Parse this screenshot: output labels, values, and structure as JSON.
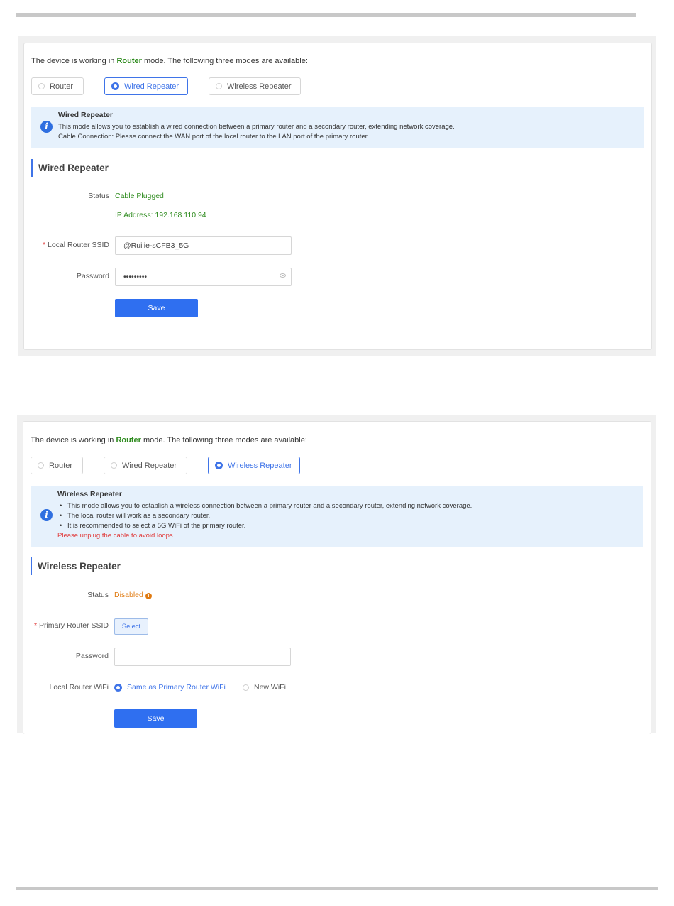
{
  "panel_wired": {
    "intro": {
      "prefix": "The device is working in ",
      "mode": "Router",
      "suffix": " mode. The following three modes are available:"
    },
    "modes": [
      {
        "label": "Router",
        "selected": false
      },
      {
        "label": "Wired Repeater",
        "selected": true
      },
      {
        "label": "Wireless Repeater",
        "selected": false
      }
    ],
    "info": {
      "title": "Wired Repeater",
      "lines": [
        "This mode allows you to establish a wired connection between a primary router and a secondary router, extending network coverage.",
        "Cable Connection: Please connect the WAN port of the local router to the LAN port of the primary router."
      ]
    },
    "section_title": "Wired Repeater",
    "status_label": "Status",
    "status_value": "Cable Plugged",
    "ip_line": "IP Address: 192.168.110.94",
    "ssid_required": "*",
    "ssid_label": "Local Router SSID",
    "ssid_value": "@Ruijie-sCFB3_5G",
    "password_label": "Password",
    "password_value": "•••••••••",
    "save_label": "Save"
  },
  "panel_wireless": {
    "intro": {
      "prefix": "The device is working in ",
      "mode": "Router",
      "suffix": " mode. The following three modes are available:"
    },
    "modes": [
      {
        "label": "Router",
        "selected": false
      },
      {
        "label": "Wired Repeater",
        "selected": false
      },
      {
        "label": "Wireless Repeater",
        "selected": true
      }
    ],
    "info": {
      "title": "Wireless Repeater",
      "bullets": [
        "This mode allows you to establish a wireless connection between a primary router and a secondary router, extending network coverage.",
        "The local router will work as a secondary router.",
        "It is recommended to select a 5G WiFi of the primary router."
      ],
      "warning": "Please unplug the cable to avoid loops."
    },
    "section_title": "Wireless Repeater",
    "status_label": "Status",
    "status_value": "Disabled",
    "ssid_required": "*",
    "ssid_label": "Primary Router SSID",
    "select_label": "Select",
    "password_label": "Password",
    "password_value": "",
    "wifi_label": "Local Router WiFi",
    "wifi_options": [
      {
        "label": "Same as Primary Router WiFi",
        "selected": true
      },
      {
        "label": "New WiFi",
        "selected": false
      }
    ],
    "save_label": "Save"
  },
  "colors": {
    "accent": "#3f74e8",
    "button": "#2f6ff0",
    "success": "#2e8b1e",
    "warning": "#e07b12",
    "error": "#e03c3c",
    "info_bg": "#e6f1fc"
  }
}
